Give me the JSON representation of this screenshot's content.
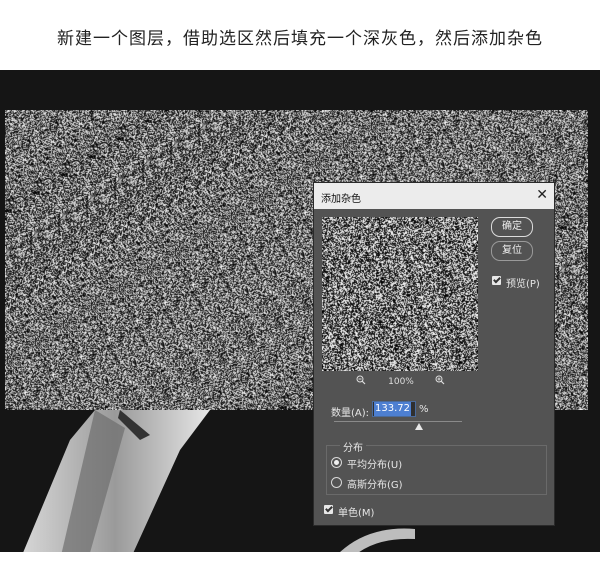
{
  "caption": "新建一个图层，借助选区然后填充一个深灰色，然后添加杂色",
  "dialog": {
    "title": "添加杂色",
    "ok_label": "确定",
    "reset_label": "复位",
    "preview_label": "预览(P)",
    "preview_checked": true,
    "zoom_level": "100%",
    "amount_label": "数量(A):",
    "amount_value": "133.72",
    "amount_unit": "%",
    "distribution_title": "分布",
    "distribution_options": [
      {
        "label": "平均分布(U)",
        "selected": true
      },
      {
        "label": "高斯分布(G)",
        "selected": false
      }
    ],
    "monochrome_label": "单色(M)",
    "monochrome_checked": true
  },
  "colors": {
    "dialog_bg": "#535353",
    "canvas_bg": "#151515",
    "selection_accent": "#4d7fd1"
  },
  "icons": [
    "close-icon",
    "zoom-out-icon",
    "zoom-in-icon",
    "checkbox-checked-icon",
    "radio-selected-icon"
  ]
}
